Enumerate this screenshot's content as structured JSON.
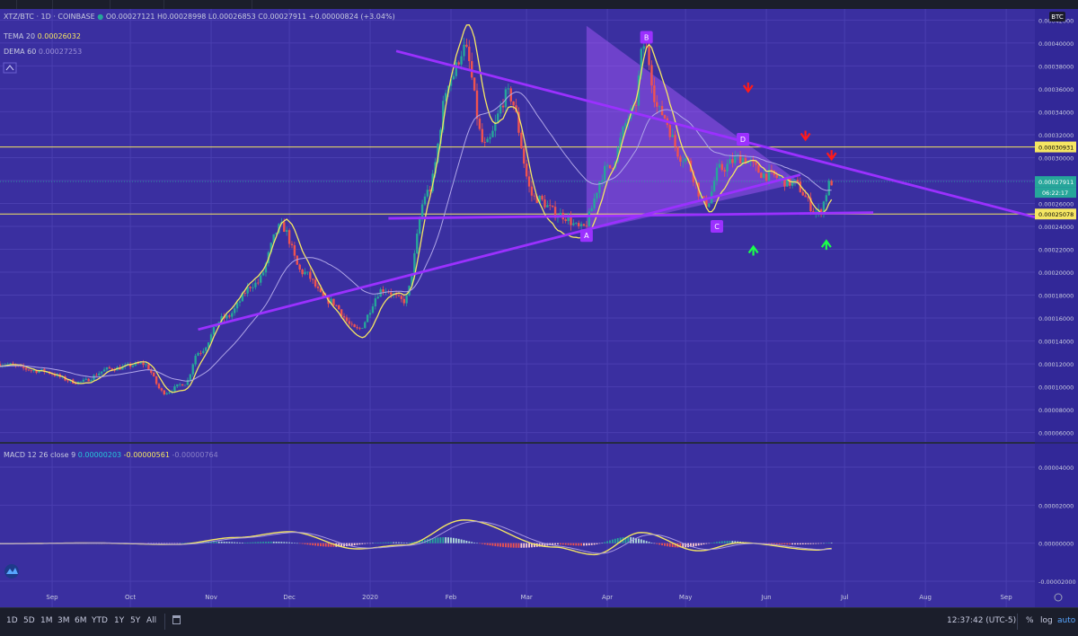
{
  "header": {
    "symbol": "XTZ/BTC · 1D · COINBASE",
    "ohlc": "O0.00027121 H0.00028998 L0.00026853 C0.00027911 +0.00000824 (+3.04%)",
    "currency_badge": "BTC"
  },
  "indicators": {
    "tema_label": "TEMA 20",
    "tema_value": "0.00026032",
    "dema_label": "DEMA 60",
    "dema_value": "0.00027253",
    "macd_label": "MACD 12 26 close 9",
    "macd_v1": "0.00000203",
    "macd_v2": "-0.00000561",
    "macd_v3": "-0.00000764"
  },
  "price_axis": {
    "ticks": [
      "0.00042000",
      "0.00040000",
      "0.00038000",
      "0.00036000",
      "0.00034000",
      "0.00032000",
      "0.00030000",
      "0.00028000",
      "0.00026000",
      "0.00024000",
      "0.00022000",
      "0.00020000",
      "0.00018000",
      "0.00016000",
      "0.00014000",
      "0.00012000",
      "0.00010000",
      "0.00008000",
      "0.00006000"
    ],
    "tags": {
      "upper_line": "0.00030931",
      "last_price": "0.00027911",
      "countdown": "06:22:17",
      "lower_line": "0.00025078"
    }
  },
  "macd_axis": {
    "ticks": [
      "0.00004000",
      "0.00002000",
      "0.00000000",
      "-0.00002000"
    ]
  },
  "time_axis": {
    "labels": [
      "Sep",
      "Oct",
      "Nov",
      "Dec",
      "2020",
      "Feb",
      "Mar",
      "Apr",
      "May",
      "Jun",
      "Jul",
      "Aug",
      "Sep"
    ]
  },
  "pattern_labels": [
    "A",
    "B",
    "C",
    "D"
  ],
  "timeframes": [
    "1D",
    "5D",
    "1M",
    "3M",
    "6M",
    "YTD",
    "1Y",
    "5Y",
    "All"
  ],
  "bottom_right": {
    "time": "12:37:42 (UTC-5)",
    "pct": "%",
    "log": "log",
    "auto": "auto"
  },
  "colors": {
    "background": "#3a2fa0",
    "grid": "#4a3fb0",
    "candle_up": "#26a69a",
    "candle_down": "#ef5350",
    "trendline": "#9b30ff",
    "yellow_line": "#f5e663",
    "tema": "#f5e663",
    "dema": "#b0a6e8",
    "macd_line": "#f5e663",
    "signal_line": "#a898e0",
    "triangle_fill": "#b05cff",
    "red_arrow": "#ff1a1a",
    "green_arrow": "#1aff4a"
  },
  "chart_data": {
    "type": "candlestick",
    "title": "XTZ/BTC 1D COINBASE",
    "x_range": [
      "2019-08-26",
      "2020-09-26"
    ],
    "price_range": [
      5.5e-05,
      0.000425
    ],
    "key_levels": {
      "horizontal_upper": 0.00030931,
      "horizontal_lower": 0.00025078,
      "support_line": 0.000246
    },
    "price_path": [
      {
        "date": "2019-08-26",
        "close": 0.00012
      },
      {
        "date": "2019-09-10",
        "close": 0.000114
      },
      {
        "date": "2019-09-25",
        "close": 0.000104
      },
      {
        "date": "2019-10-08",
        "close": 0.000116
      },
      {
        "date": "2019-10-20",
        "close": 0.00012
      },
      {
        "date": "2019-10-28",
        "close": 9.5e-05
      },
      {
        "date": "2019-11-05",
        "close": 0.000103
      },
      {
        "date": "2019-11-10",
        "close": 0.00013
      },
      {
        "date": "2019-11-20",
        "close": 0.00016
      },
      {
        "date": "2019-12-02",
        "close": 0.00019
      },
      {
        "date": "2019-12-12",
        "close": 0.00024
      },
      {
        "date": "2019-12-20",
        "close": 0.0002
      },
      {
        "date": "2019-12-30",
        "close": 0.000175
      },
      {
        "date": "2020-01-10",
        "close": 0.00015
      },
      {
        "date": "2020-01-20",
        "close": 0.000185
      },
      {
        "date": "2020-01-28",
        "close": 0.000175
      },
      {
        "date": "2020-02-06",
        "close": 0.00027
      },
      {
        "date": "2020-02-15",
        "close": 0.00037
      },
      {
        "date": "2020-02-20",
        "close": 0.000395
      },
      {
        "date": "2020-02-28",
        "close": 0.00031
      },
      {
        "date": "2020-03-08",
        "close": 0.000355
      },
      {
        "date": "2020-03-18",
        "close": 0.000265
      },
      {
        "date": "2020-03-28",
        "close": 0.00025
      },
      {
        "date": "2020-04-05",
        "close": 0.000238
      },
      {
        "date": "2020-04-15",
        "close": 0.00029
      },
      {
        "date": "2020-04-25",
        "close": 0.00034
      },
      {
        "date": "2020-04-29",
        "close": 0.000398
      },
      {
        "date": "2020-05-05",
        "close": 0.00034
      },
      {
        "date": "2020-05-14",
        "close": 0.0003
      },
      {
        "date": "2020-05-23",
        "close": 0.00026
      },
      {
        "date": "2020-05-28",
        "close": 0.00029
      },
      {
        "date": "2020-06-05",
        "close": 0.0003
      },
      {
        "date": "2020-06-15",
        "close": 0.000285
      },
      {
        "date": "2020-06-25",
        "close": 0.000278
      },
      {
        "date": "2020-07-05",
        "close": 0.000252
      },
      {
        "date": "2020-07-10",
        "close": 0.000279
      }
    ],
    "macd_path": [
      {
        "date": "2019-08-26",
        "macd": -3e-07
      },
      {
        "date": "2019-10-01",
        "macd": 1e-07
      },
      {
        "date": "2019-11-01",
        "macd": -7e-07
      },
      {
        "date": "2019-11-25",
        "macd": 3e-06
      },
      {
        "date": "2019-12-15",
        "macd": 6e-06
      },
      {
        "date": "2020-01-10",
        "macd": -3e-06
      },
      {
        "date": "2020-01-28",
        "macd": -1e-06
      },
      {
        "date": "2020-02-20",
        "macd": 1.22e-05
      },
      {
        "date": "2020-03-25",
        "macd": -2e-06
      },
      {
        "date": "2020-04-10",
        "macd": -6e-06
      },
      {
        "date": "2020-04-28",
        "macd": 5.6e-06
      },
      {
        "date": "2020-05-20",
        "macd": -4e-06
      },
      {
        "date": "2020-06-05",
        "macd": 2e-07
      },
      {
        "date": "2020-07-05",
        "macd": -3.6e-06
      },
      {
        "date": "2020-07-10",
        "macd": -2.8e-06
      }
    ],
    "macd_range": [
      -2e-05,
      4e-05
    ]
  }
}
